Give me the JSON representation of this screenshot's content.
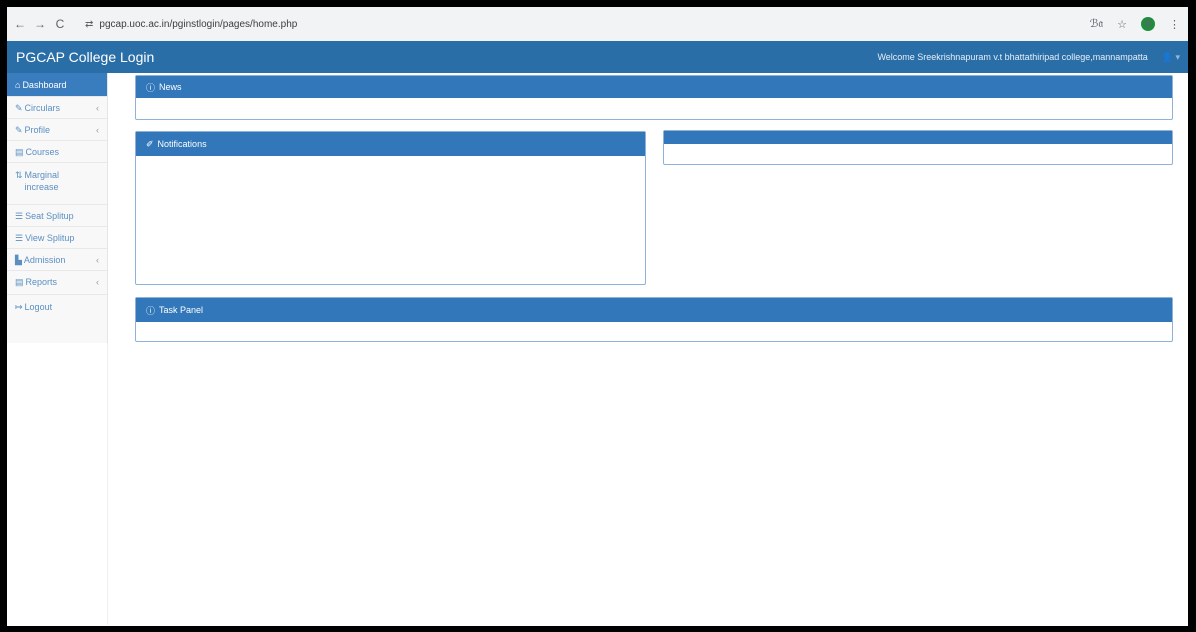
{
  "browser": {
    "url": "pgcap.uoc.ac.in/pginstlogin/pages/home.php",
    "back": "←",
    "forward": "→",
    "reload": "C",
    "site_icon": "⇄",
    "translate": "ℬ𝔞",
    "star": "☆",
    "profile": "0",
    "menu": "⋮"
  },
  "header": {
    "title": "PGCAP College Login",
    "welcome": "Welcome Sreekrishnapuram v.t bhattathiripad college,mannampatta",
    "user_menu": "👤 ▾"
  },
  "sidebar": {
    "items": [
      {
        "icon": "⌂",
        "label": "Dashboard",
        "chevron": ""
      },
      {
        "icon": "✎",
        "label": "Circulars",
        "chevron": "‹"
      },
      {
        "icon": "✎",
        "label": "Profile",
        "chevron": "‹"
      },
      {
        "icon": "▤",
        "label": "Courses",
        "chevron": ""
      },
      {
        "icon": "⇅",
        "label": "Marginal increase",
        "chevron": ""
      },
      {
        "icon": "☰",
        "label": "Seat Splitup",
        "chevron": ""
      },
      {
        "icon": "☰",
        "label": "View Splitup",
        "chevron": ""
      },
      {
        "icon": "▙",
        "label": "Admission",
        "chevron": "‹"
      },
      {
        "icon": "▤",
        "label": "Reports",
        "chevron": "‹"
      },
      {
        "icon": "↦",
        "label": "Logout",
        "chevron": ""
      }
    ]
  },
  "panels": {
    "news": {
      "icon": "ⓘ",
      "title": "News"
    },
    "notifications": {
      "icon": "✐",
      "title": "Notifications"
    },
    "right": {
      "icon": "",
      "title": ""
    },
    "task": {
      "icon": "ⓘ",
      "title": "Task Panel"
    }
  },
  "colors": {
    "header": "#2a6ea8",
    "panel_head": "#3177b9",
    "sidebar_active": "#3a7dbf",
    "link": "#5a8fc2"
  }
}
